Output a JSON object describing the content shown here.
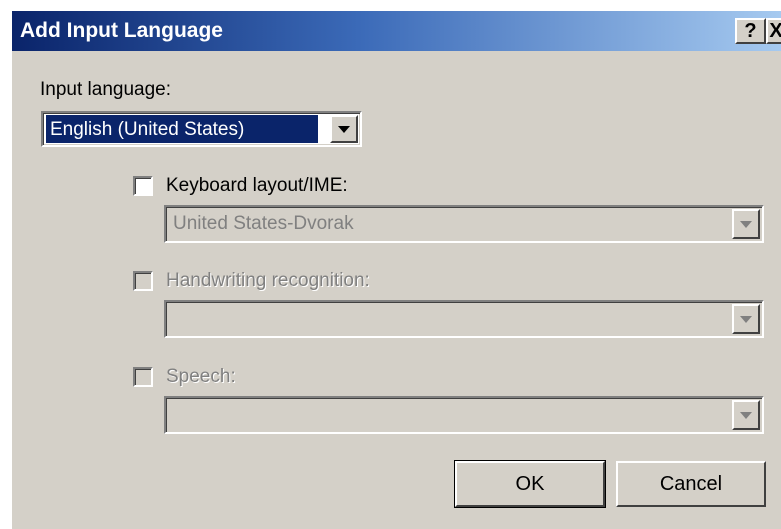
{
  "window": {
    "title": "Add Input Language",
    "help_label": "?",
    "close_label": "X"
  },
  "input_language": {
    "label": "Input language:",
    "value": "English (United States)"
  },
  "keyboard_layout": {
    "label": "Keyboard layout/IME:",
    "checked": false,
    "enabled": true,
    "value": "United States-Dvorak"
  },
  "handwriting": {
    "label": "Handwriting recognition:",
    "checked": false,
    "enabled": false,
    "value": ""
  },
  "speech": {
    "label": "Speech:",
    "checked": false,
    "enabled": false,
    "value": ""
  },
  "buttons": {
    "ok": "OK",
    "cancel": "Cancel"
  },
  "colors": {
    "titlebar_start": "#0a246a",
    "titlebar_end": "#a6caf0",
    "dialog_bg": "#d4d0c8",
    "selection": "#0a246a"
  }
}
